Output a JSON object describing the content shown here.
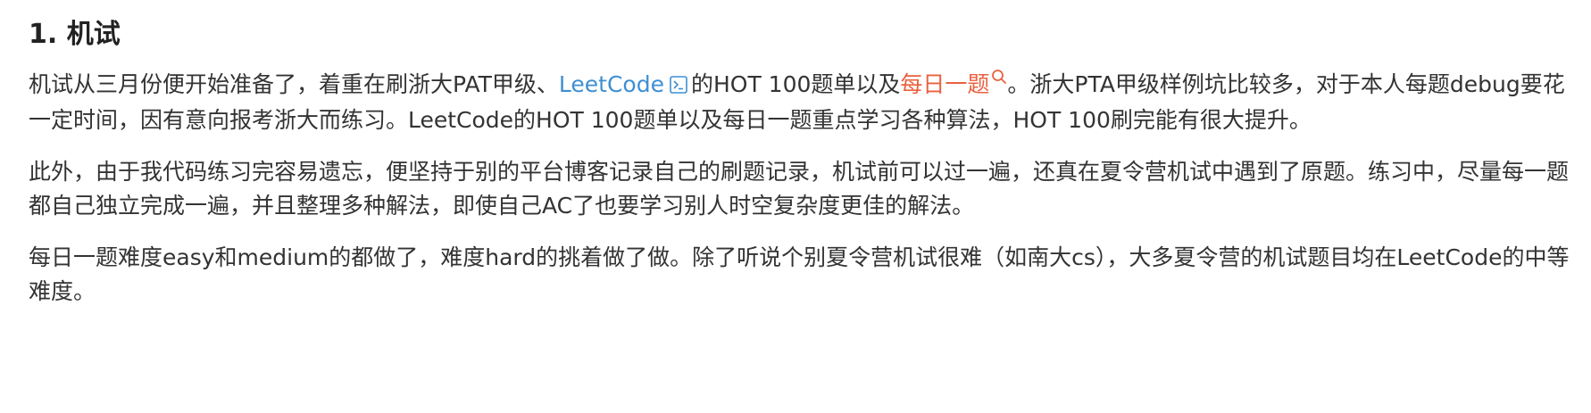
{
  "section": {
    "title": "1. 机试"
  },
  "paragraph1": {
    "text_before_link": "机试从三月份便开始准备了，着重在刷浙大PAT甲级、",
    "link_leetcode": "LeetCode",
    "text_middle": "的HOT 100题单以及",
    "link_daily": "每日一题",
    "text_after": "。浙大PTA甲级样例坑比较多，对于本人每题debug要花一定时间，因有意向报考浙大而练习。LeetCode的HOT 100题单以及每日一题重点学习各种算法，HOT 100刷完能有很大提升。"
  },
  "paragraph2": {
    "text": "此外，由于我代码练习完容易遗忘，便坚持于别的平台博客记录自己的刷题记录，机试前可以过一遍，还真在夏令营机试中遇到了原题。练习中，尽量每一题都自己独立完成一遍，并且整理多种解法，即使自己AC了也要学习别人时空复杂度更佳的解法。"
  },
  "paragraph3": {
    "text": "每日一题难度easy和medium的都做了，难度hard的挑着做了做。除了听说个别夏令营机试很难（如南大cs），大多夏令营的机试题目均在LeetCode的中等难度。"
  },
  "colors": {
    "link": "#3f8fd2",
    "highlight_link": "#e9613f",
    "text": "#333333",
    "heading": "#222222"
  },
  "icons": {
    "leetcode_link_icon": "terminal-box-icon",
    "daily_search_icon": "search-icon"
  }
}
